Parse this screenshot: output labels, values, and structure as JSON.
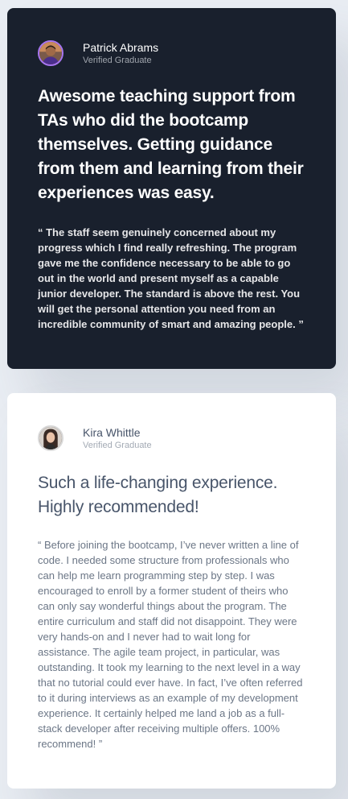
{
  "testimonials": [
    {
      "name": "Patrick Abrams",
      "status": "Verified Graduate",
      "avatar_icon": "avatar-photo-icon",
      "avatar_border": "#a775f1",
      "headline": "Awesome teaching support from TAs who did the bootcamp themselves. Getting guidance from them and learning from their experiences was easy.",
      "quote": "“ The staff seem genuinely concerned about my progress which I find really refreshing. The program gave me the confidence necessary to be able to go out in the world and present myself as a capable junior developer. The standard is above the rest. You will get the personal attention you need from an incredible community of smart and amazing people. ”",
      "background": "#19202d"
    },
    {
      "name": "Kira Whittle",
      "status": "Verified Graduate",
      "avatar_icon": "avatar-photo-icon",
      "avatar_border": "#d9d9d9",
      "headline": "Such a life-changing experience. Highly recommended!",
      "quote": "“ Before joining the bootcamp, I’ve never written a line of code. I needed some structure from professionals who can help me learn programming step by step. I was encouraged to enroll by a former student of theirs who can only say wonderful things about the program. The entire curriculum and staff did not disappoint. They were very hands-on and I never had to wait long for assistance. The agile team project, in particular, was outstanding. It took my learning to the next level in a way that no tutorial could ever have. In fact, I’ve often referred to it during interviews as an example of my development experience. It certainly helped me land a job as a full-stack developer after receiving multiple offers. 100% recommend! ”",
      "background": "#ffffff"
    }
  ]
}
